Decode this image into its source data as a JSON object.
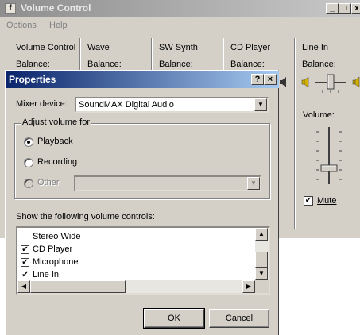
{
  "volume_window": {
    "title": "Volume Control",
    "icon_glyph": "f",
    "menu": [
      "Options",
      "Help"
    ],
    "captions": {
      "minimize": "_",
      "maximize": "□",
      "close": "x"
    },
    "columns": [
      {
        "title": "Volume Control",
        "balance": "Balance:"
      },
      {
        "title": "Wave",
        "balance": "Balance:"
      },
      {
        "title": "SW Synth",
        "balance": "Balance:"
      },
      {
        "title": "CD Player",
        "balance": "Balance:"
      },
      {
        "title": "Line In",
        "balance": "Balance:"
      }
    ],
    "volume_label": "Volume:",
    "mute_label": "Mute",
    "mute_checked": true
  },
  "dialog": {
    "title": "Properties",
    "help_button": "?",
    "close_button": "×",
    "mixer_device_label": "Mixer device:",
    "mixer_device_value": "SoundMAX Digital Audio",
    "adjust_group_label": "Adjust volume for",
    "radio_options": [
      {
        "label": "Playback",
        "checked": true,
        "enabled": true
      },
      {
        "label": "Recording",
        "checked": false,
        "enabled": true
      },
      {
        "label": "Other",
        "checked": false,
        "enabled": false
      }
    ],
    "show_controls_label": "Show the following volume controls:",
    "controls": [
      {
        "label": "Stereo Wide",
        "checked": false
      },
      {
        "label": "CD Player",
        "checked": true
      },
      {
        "label": "Microphone",
        "checked": true
      },
      {
        "label": "Line In",
        "checked": true
      }
    ],
    "ok_button": "OK",
    "cancel_button": "Cancel"
  }
}
